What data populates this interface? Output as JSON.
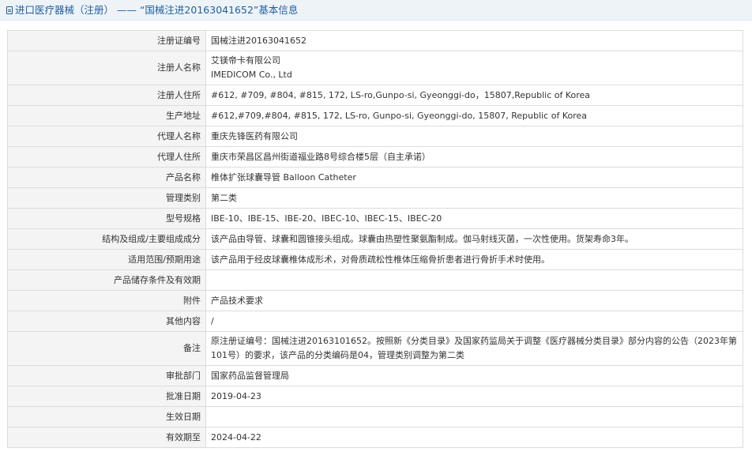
{
  "header": {
    "title": "进口医疗器械（注册） —— “国械注进20163041652”基本信息"
  },
  "rows": [
    {
      "label": "注册证编号",
      "value": "国械注进20163041652"
    },
    {
      "label": "注册人名称",
      "value": "艾镁帝卡有限公司",
      "value2": "IMEDICOM Co., Ltd"
    },
    {
      "label": "注册人住所",
      "value": "#612, #709, #804, #815, 172, LS-ro,Gunpo-si, Gyeonggi-do，15807,Republic of Korea"
    },
    {
      "label": "生产地址",
      "value": "#612,#709,#804, #815, 172, LS-ro, Gunpo-si, Gyeonggi-do, 15807, Republic of Korea"
    },
    {
      "label": "代理人名称",
      "value": "重庆先锋医药有限公司"
    },
    {
      "label": "代理人住所",
      "value": "重庆市荣昌区昌州街道福业路8号综合楼5层（自主承诺）"
    },
    {
      "label": "产品名称",
      "value": "椎体扩张球囊导管 Balloon Catheter"
    },
    {
      "label": "管理类别",
      "value": "第二类"
    },
    {
      "label": "型号规格",
      "value": "IBE-10、IBE-15、IBE-20、IBEC-10、IBEC-15、IBEC-20"
    },
    {
      "label": "结构及组成/主要组成成分",
      "value": "该产品由导管、球囊和圆锥接头组成。球囊由热塑性聚氨酯制成。伽马射线灭菌，一次性使用。货架寿命3年。"
    },
    {
      "label": "适用范围/预期用途",
      "value": "该产品用于经皮球囊椎体成形术，对骨质疏松性椎体压缩骨折患者进行骨折手术时使用。"
    },
    {
      "label": "产品储存条件及有效期",
      "value": ""
    },
    {
      "label": "附件",
      "value": "产品技术要求"
    },
    {
      "label": "其他内容",
      "value": "/"
    },
    {
      "label": "备注",
      "value": "原注册证编号：国械注进20163101652。按照新《分类目录》及国家药监局关于调整《医疗器械分类目录》部分内容的公告（2023年第101号）的要求，该产品的分类编码是04，管理类别调整为第二类"
    },
    {
      "label": "审批部门",
      "value": "国家药品监督管理局"
    },
    {
      "label": "批准日期",
      "value": "2019-04-23"
    },
    {
      "label": "生效日期",
      "value": ""
    },
    {
      "label": "有效期至",
      "value": "2024-04-22"
    }
  ]
}
